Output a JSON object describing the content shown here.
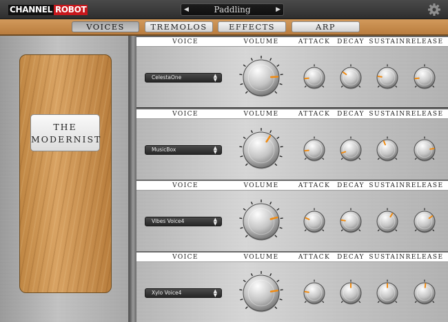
{
  "app": {
    "logo_left": "CHANNEL",
    "logo_right": "ROBOT",
    "preset_name": "Paddling",
    "prev_arrow": "◀",
    "next_arrow": "▶",
    "settings_icon": "gear-icon"
  },
  "tabs": [
    {
      "label": "VOICES",
      "active": true
    },
    {
      "label": "TREMOLOS",
      "active": false
    },
    {
      "label": "EFFECTS",
      "active": false
    },
    {
      "label": "ARP",
      "active": false
    }
  ],
  "instrument": {
    "line1": "THE",
    "line2": "MODERNIST"
  },
  "column_headers": {
    "voice": "VOICE",
    "volume": "VOLUME",
    "attack": "ATTACK",
    "decay": "DECAY",
    "sustain": "SUSTAIN",
    "release": "RELEASE"
  },
  "voices": [
    {
      "name": "CelestaOne",
      "volume": 0.82,
      "attack": 0.15,
      "decay": 0.3,
      "sustain": 0.2,
      "release": 0.15
    },
    {
      "name": "MusicBox",
      "volume": 0.62,
      "attack": 0.15,
      "decay": 0.1,
      "sustain": 0.42,
      "release": 0.8
    },
    {
      "name": "Vibes Voice4",
      "volume": 0.78,
      "attack": 0.25,
      "decay": 0.2,
      "sustain": 0.62,
      "release": 0.7
    },
    {
      "name": "Xylo Voice4",
      "volume": 0.8,
      "attack": 0.2,
      "decay": 0.5,
      "sustain": 0.5,
      "release": 0.52
    }
  ],
  "colors": {
    "knob_indicator": "#f08a10",
    "wood": "#d8a262",
    "selector_bg": "#2e2e2e"
  }
}
